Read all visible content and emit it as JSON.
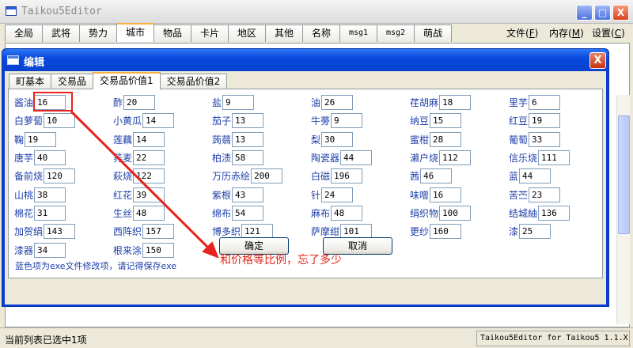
{
  "app": {
    "title": "Taikou5Editor",
    "window_buttons": [
      "_",
      "□",
      "X"
    ]
  },
  "main_tabs": [
    {
      "label": "全局",
      "small": false
    },
    {
      "label": "武将",
      "small": false
    },
    {
      "label": "势力",
      "small": false
    },
    {
      "label": "城市",
      "small": false,
      "active": true
    },
    {
      "label": "物品",
      "small": false
    },
    {
      "label": "卡片",
      "small": false
    },
    {
      "label": "地区",
      "small": false
    },
    {
      "label": "其他",
      "small": false
    },
    {
      "label": "名称",
      "small": false
    },
    {
      "label": "msg1",
      "small": true
    },
    {
      "label": "msg2",
      "small": true
    },
    {
      "label": "萌战",
      "small": false
    }
  ],
  "menu": {
    "file": "文件",
    "file_key": "F",
    "memory": "内存",
    "memory_key": "M",
    "settings": "设置",
    "settings_key": "C"
  },
  "dialog": {
    "title": "编辑",
    "close_glyph": "X",
    "tabs": [
      "町基本",
      "交易品",
      "交易品价值1",
      "交易品价值2"
    ],
    "active_tab": 2,
    "items": [
      {
        "label": "酱油",
        "value": "16"
      },
      {
        "label": "酢",
        "value": "20"
      },
      {
        "label": "盐",
        "value": "9"
      },
      {
        "label": "油",
        "value": "26"
      },
      {
        "label": "荏胡麻",
        "value": "18"
      },
      {
        "label": "里芋",
        "value": "6"
      },
      {
        "label": "白萝蔔",
        "value": "10"
      },
      {
        "label": "小黄瓜",
        "value": "14"
      },
      {
        "label": "茄子",
        "value": "13"
      },
      {
        "label": "牛蒡",
        "value": "9"
      },
      {
        "label": "纳豆",
        "value": "15"
      },
      {
        "label": "红豆",
        "value": "19"
      },
      {
        "label": "鞠",
        "value": "19"
      },
      {
        "label": "莲藕",
        "value": "14"
      },
      {
        "label": "蒟蒻",
        "value": "13"
      },
      {
        "label": "梨",
        "value": "30"
      },
      {
        "label": "蜜柑",
        "value": "28"
      },
      {
        "label": "葡萄",
        "value": "33"
      },
      {
        "label": "唐芋",
        "value": "40"
      },
      {
        "label": "荞麦",
        "value": "22"
      },
      {
        "label": "柏渍",
        "value": "58"
      },
      {
        "label": "陶瓷器",
        "value": "44"
      },
      {
        "label": "濑户烧",
        "value": "112"
      },
      {
        "label": "信乐烧",
        "value": "111"
      },
      {
        "label": "备前烧",
        "value": "120"
      },
      {
        "label": "萩烧",
        "value": "122"
      },
      {
        "label": "万历赤绘",
        "value": "200"
      },
      {
        "label": "白磁",
        "value": "196"
      },
      {
        "label": "茜",
        "value": "46"
      },
      {
        "label": "蓝",
        "value": "44"
      },
      {
        "label": "山桃",
        "value": "38"
      },
      {
        "label": "红花",
        "value": "39"
      },
      {
        "label": "紫根",
        "value": "43"
      },
      {
        "label": "针",
        "value": "24"
      },
      {
        "label": "味噌",
        "value": "16"
      },
      {
        "label": "苦苎",
        "value": "23"
      },
      {
        "label": "棉花",
        "value": "31"
      },
      {
        "label": "生丝",
        "value": "48"
      },
      {
        "label": "绵布",
        "value": "54"
      },
      {
        "label": "麻布",
        "value": "48"
      },
      {
        "label": "绢织物",
        "value": "100"
      },
      {
        "label": "结城紬",
        "value": "136"
      },
      {
        "label": "加贺绢",
        "value": "143"
      },
      {
        "label": "西阵织",
        "value": "157"
      },
      {
        "label": "博多织",
        "value": "121"
      },
      {
        "label": "萨摩绀",
        "value": "101"
      },
      {
        "label": "更纱",
        "value": "160"
      },
      {
        "label": "漆",
        "value": "25"
      },
      {
        "label": "漆器",
        "value": "34"
      },
      {
        "label": "根来涂",
        "value": "150"
      }
    ],
    "hint": "蓝色项为exe文件修改项，请记得保存exe",
    "ok_label": "确定",
    "cancel_label": "取消"
  },
  "annotation": "和价格等比例，忘了多少",
  "status": {
    "left": "当前列表已选中1项",
    "right": "Taikou5Editor for Taikou5 1.1.X"
  },
  "colors": {
    "dialog_title": "#0a49de",
    "label_blue": "#1e3fa9",
    "annotation_red": "#e22416"
  }
}
